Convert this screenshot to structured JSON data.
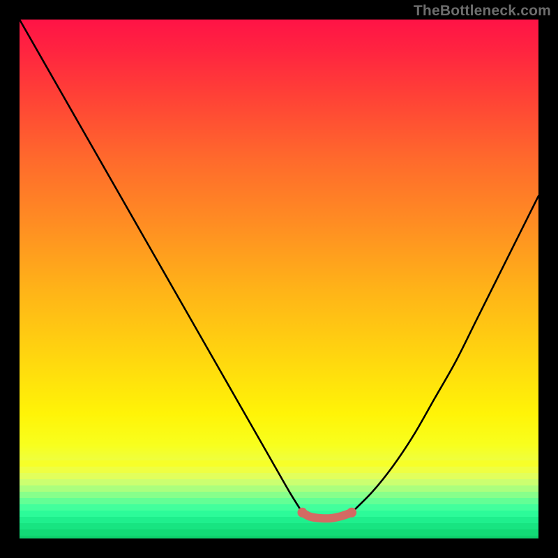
{
  "watermark": "TheBottleneck.com",
  "colors": {
    "frame": "#000000",
    "curve_stroke": "#000000",
    "valley_highlight": "#d46a63"
  },
  "chart_data": {
    "type": "line",
    "title": "",
    "xlabel": "",
    "ylabel": "",
    "xlim": [
      0,
      100
    ],
    "ylim": [
      0,
      100
    ],
    "grid": false,
    "series": [
      {
        "name": "left-branch",
        "x": [
          0,
          4,
          8,
          12,
          16,
          20,
          24,
          28,
          32,
          36,
          40,
          44,
          48,
          52,
          54.5
        ],
        "y": [
          100,
          93,
          86,
          79,
          72,
          65,
          58,
          51,
          44,
          37,
          30,
          23,
          16,
          9,
          5
        ]
      },
      {
        "name": "right-branch",
        "x": [
          64,
          68,
          72,
          76,
          80,
          84,
          88,
          92,
          96,
          100
        ],
        "y": [
          5,
          9,
          14,
          20,
          27,
          34,
          42,
          50,
          58,
          66
        ]
      },
      {
        "name": "valley-highlight",
        "x": [
          54.5,
          56,
          58,
          60,
          62,
          64
        ],
        "y": [
          5,
          4.2,
          3.9,
          3.9,
          4.3,
          5
        ]
      }
    ],
    "bottom_stripes": [
      {
        "y0": 85.0,
        "y1": 86.2,
        "color": "#f7ff29"
      },
      {
        "y0": 86.2,
        "y1": 87.4,
        "color": "#efff42"
      },
      {
        "y0": 87.4,
        "y1": 88.6,
        "color": "#e2ff5c"
      },
      {
        "y0": 88.6,
        "y1": 89.8,
        "color": "#ccff70"
      },
      {
        "y0": 89.8,
        "y1": 91.0,
        "color": "#abff7e"
      },
      {
        "y0": 91.0,
        "y1": 92.2,
        "color": "#87ff8b"
      },
      {
        "y0": 92.2,
        "y1": 93.4,
        "color": "#63ff95"
      },
      {
        "y0": 93.4,
        "y1": 94.6,
        "color": "#42ff9c"
      },
      {
        "y0": 94.6,
        "y1": 95.8,
        "color": "#2cfb99"
      },
      {
        "y0": 95.8,
        "y1": 97.0,
        "color": "#1fef8d"
      },
      {
        "y0": 97.0,
        "y1": 98.2,
        "color": "#18e481"
      },
      {
        "y0": 98.2,
        "y1": 99.4,
        "color": "#12da76"
      },
      {
        "y0": 99.4,
        "y1": 100.0,
        "color": "#0ed06c"
      }
    ]
  }
}
